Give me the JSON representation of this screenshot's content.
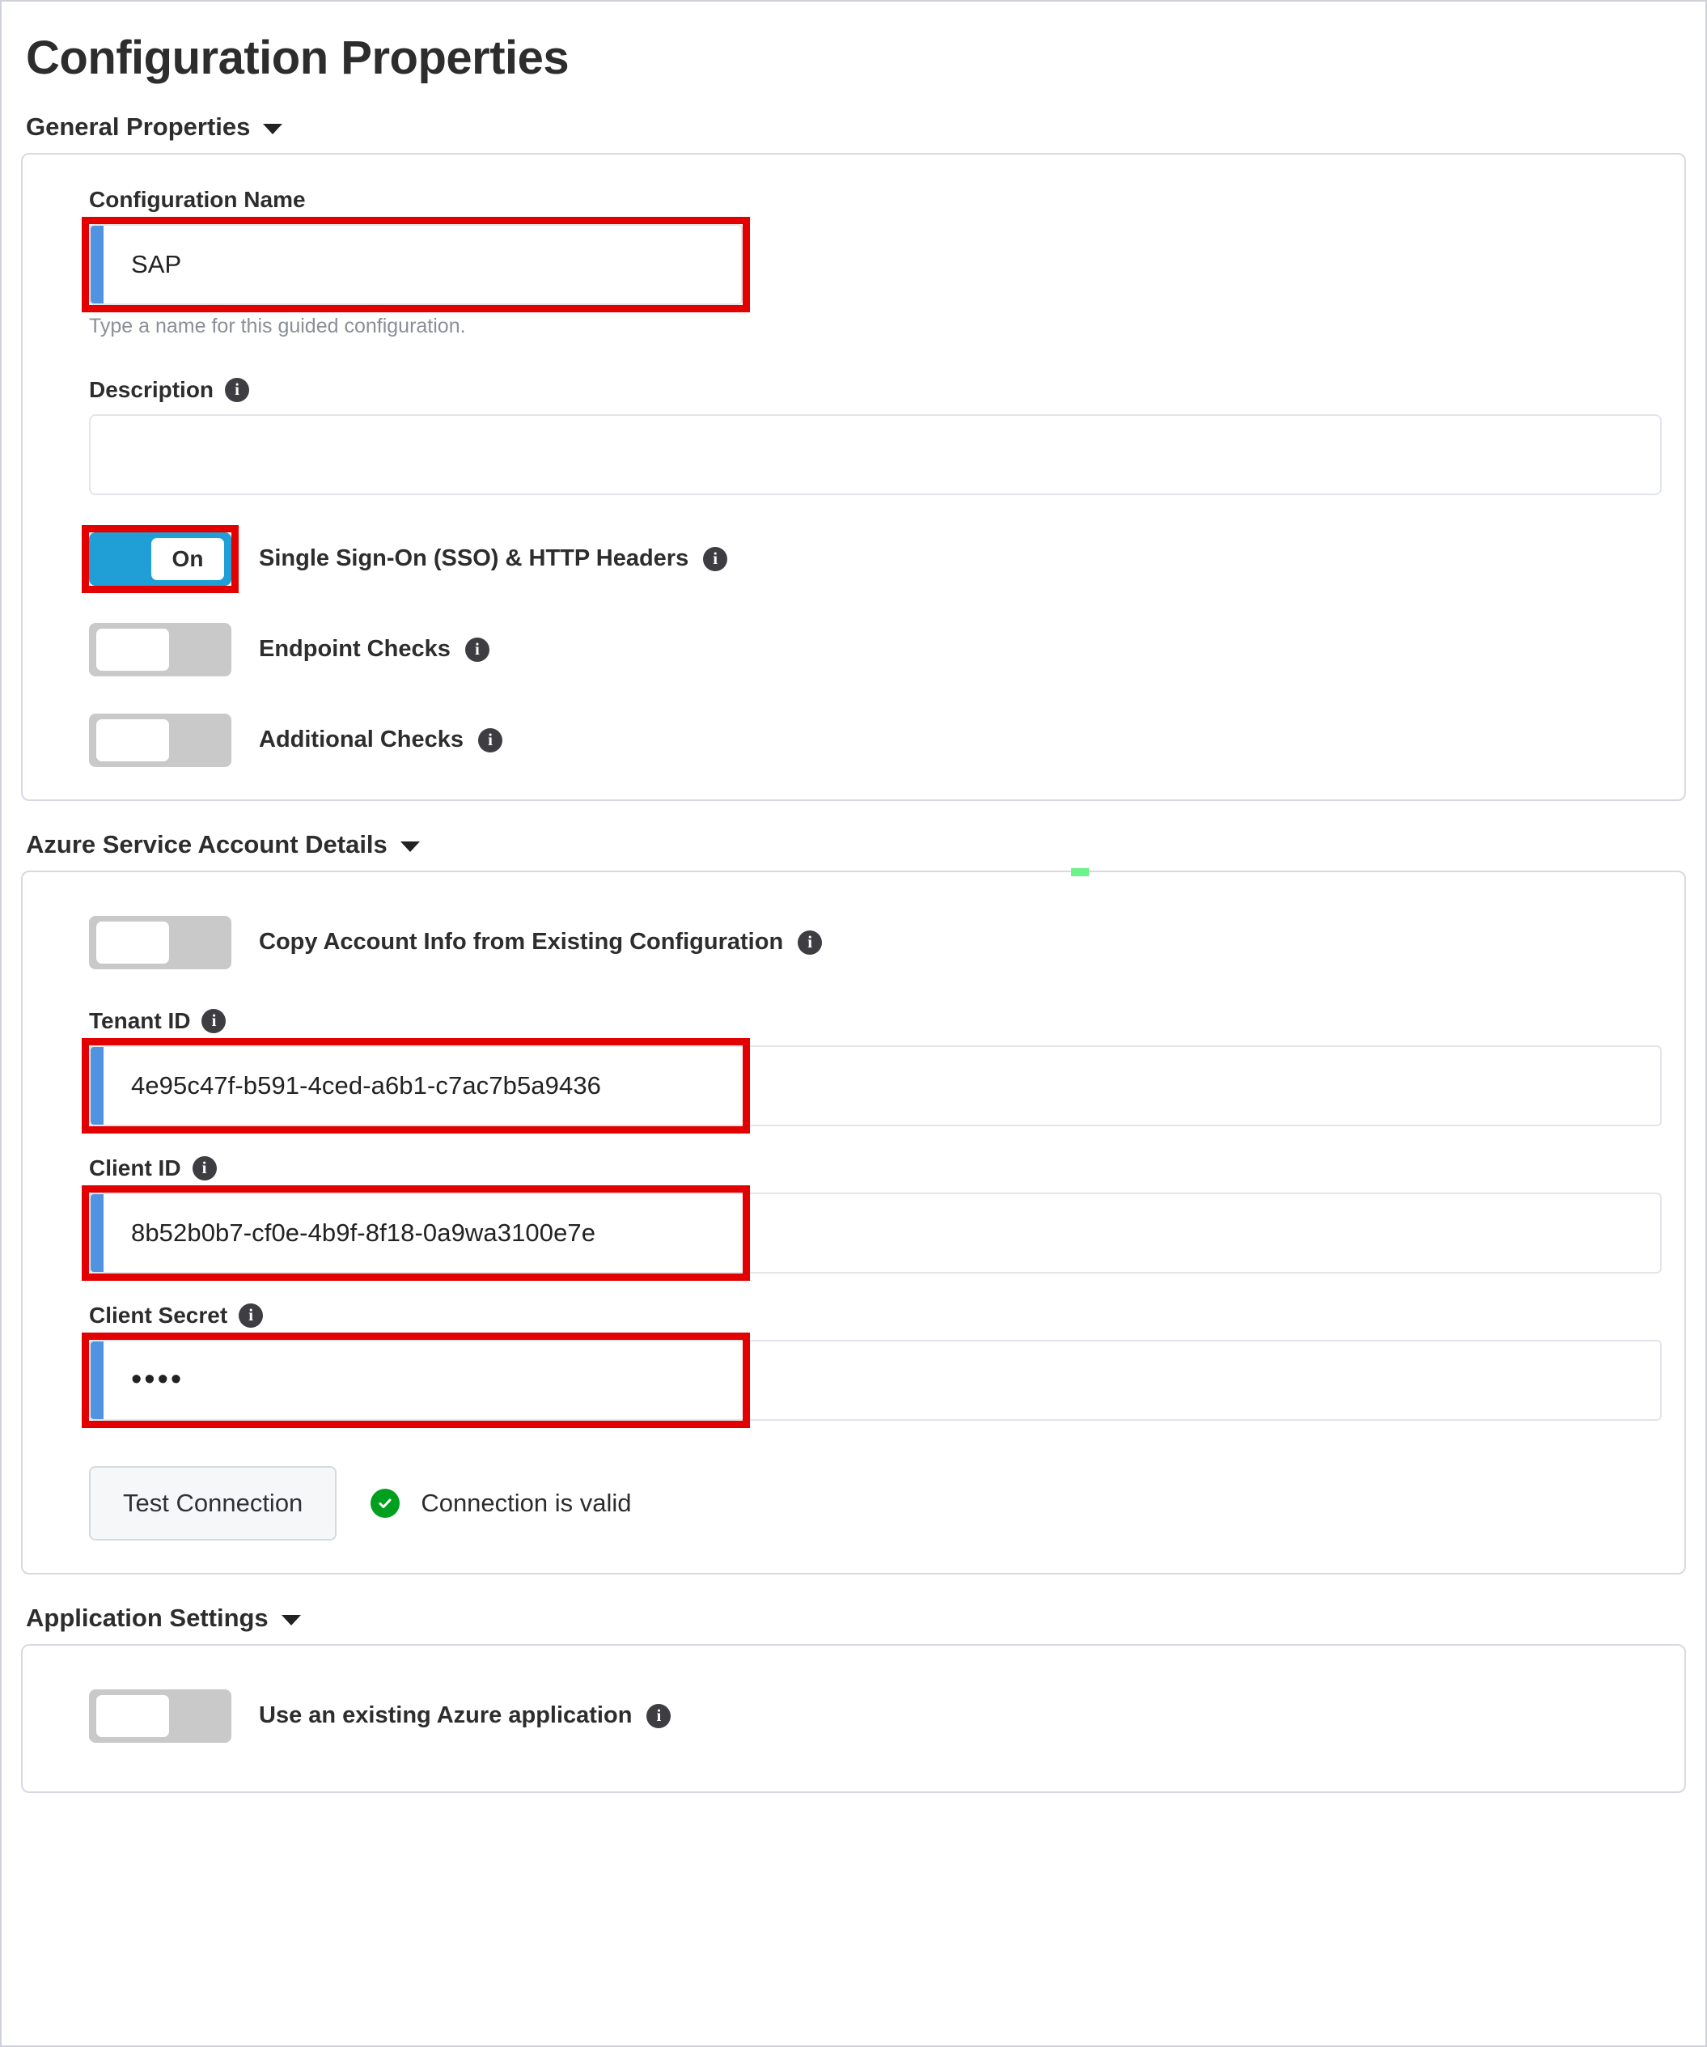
{
  "page": {
    "title": "Configuration Properties"
  },
  "sections": {
    "general": {
      "header": "General Properties",
      "caret": "chevron-down-icon",
      "config_name": {
        "label": "Configuration Name",
        "value": "SAP",
        "placeholder": "",
        "hint": "Type a name for this guided configuration."
      },
      "description": {
        "label": "Description",
        "info": "i",
        "value": "",
        "placeholder": ""
      },
      "toggles": [
        {
          "label": "Single Sign-On (SSO) & HTTP Headers",
          "state": "On",
          "on": true,
          "info": "i"
        },
        {
          "label": "Endpoint Checks",
          "state": "",
          "on": false,
          "info": "i"
        },
        {
          "label": "Additional Checks",
          "state": "",
          "on": false,
          "info": "i"
        }
      ]
    },
    "azure": {
      "header": "Azure Service Account Details",
      "caret": "chevron-down-icon",
      "copy_toggle": {
        "label": "Copy Account Info from Existing Configuration",
        "on": false,
        "info": "i"
      },
      "tenant_id": {
        "label": "Tenant ID",
        "info": "i",
        "value": "4e95c47f-b591-4ced-a6b1-c7ac7b5a9436"
      },
      "client_id": {
        "label": "Client ID",
        "info": "i",
        "value": "8b52b0b7-cf0e-4b9f-8f18-0a9wa3100e7e"
      },
      "client_secret": {
        "label": "Client Secret",
        "info": "i",
        "value": "••••"
      },
      "test_button": "Test Connection",
      "status_text": "Connection is valid",
      "status_icon": "check-circle-icon"
    },
    "application": {
      "header": "Application Settings",
      "caret": "chevron-down-icon",
      "use_existing": {
        "label": "Use an existing Azure application",
        "on": false,
        "info": "i"
      }
    }
  },
  "colors": {
    "accent_blue": "#5093e0",
    "toggle_on": "#1f9fd6",
    "highlight_red": "#e30000",
    "success_green": "#00a01e",
    "card_border": "#d6dae0"
  }
}
